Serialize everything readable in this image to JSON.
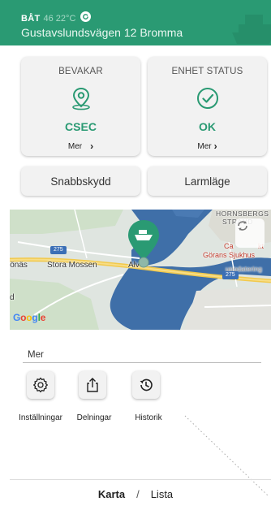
{
  "header": {
    "name": "BÅT",
    "temperature": "46 22°C",
    "address": "Gustavslundsvägen 12 Bromma"
  },
  "cards": [
    {
      "title": "BEVAKAR",
      "value": "CSEC",
      "more": "Mer",
      "icon": "location-pin-icon"
    },
    {
      "title": "ENHET STATUS",
      "value": "OK",
      "more": "Mer",
      "icon": "check-circle-icon"
    }
  ],
  "buttons": {
    "quick_protect": "Snabbskydd",
    "alarm_mode": "Larmläge"
  },
  "map": {
    "labels": {
      "hornsbergs": "HORNSBERGS",
      "strand": "STRAND",
      "stora_mossen": "Stora Mossen",
      "alv": "Alv",
      "jonas": "jönäs",
      "ca": "Ca",
      "kt": "kt",
      "gorans": "Görans Sjukhus",
      "uppdatering": "uppdatering",
      "d": "d"
    },
    "road_numbers": [
      "275",
      "275"
    ],
    "attribution": "Google"
  },
  "mer": {
    "label": "Mer",
    "tools": [
      {
        "label": "Inställningar",
        "icon": "gear-icon"
      },
      {
        "label": "Delningar",
        "icon": "share-icon"
      },
      {
        "label": "Historik",
        "icon": "history-icon"
      }
    ]
  },
  "footer": {
    "map": "Karta",
    "separator": "/",
    "list": "Lista"
  },
  "colors": {
    "brand": "#2a9a73",
    "card_bg": "#f2f2f2",
    "water": "#3f6fa8"
  }
}
